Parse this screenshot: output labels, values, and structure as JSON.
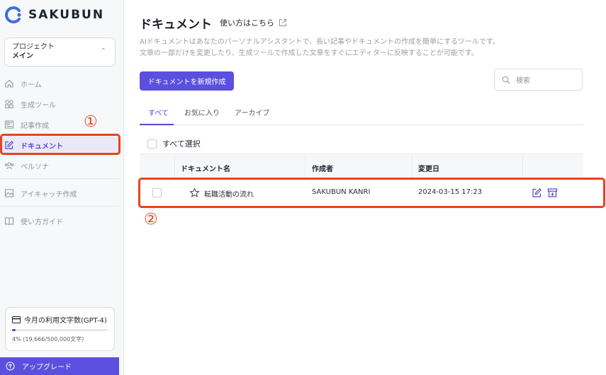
{
  "app": {
    "logo_text": "SAKUBUN"
  },
  "project": {
    "label": "プロジェクト",
    "name": "メイン"
  },
  "nav": [
    {
      "label": "ホーム",
      "icon": "home-icon"
    },
    {
      "label": "生成ツール",
      "icon": "grid-icon"
    },
    {
      "label": "記事作成",
      "icon": "article-icon"
    },
    {
      "label": "ドキュメント",
      "icon": "edit-icon",
      "active": true
    },
    {
      "label": "ペルソナ",
      "icon": "users-icon"
    },
    {
      "label": "アイキャッチ作成",
      "icon": "image-icon"
    },
    {
      "label": "使い方ガイド",
      "icon": "book-icon"
    }
  ],
  "usage": {
    "title": "今月の利用文字数(GPT-4)",
    "detail": "4% (19,666/500,000文字)",
    "percent": 4
  },
  "upgrade": {
    "label": "アップグレード"
  },
  "page": {
    "title": "ドキュメント",
    "howto": "使い方はこちら",
    "desc_line1": "AIドキュメントはあなたのパーソナルアシスタントで、長い記事やドキュメントの作成を簡単にするツールです。",
    "desc_line2": "文章の一部だけを変更したり、生成ツールで作成した文章をすぐにエディターに反映することが可能です。",
    "new_button": "ドキュメントを新規作成",
    "search_placeholder": "検索"
  },
  "tabs": [
    "すべて",
    "お気に入り",
    "アーカイブ"
  ],
  "select_all": "すべて選択",
  "table": {
    "headers": [
      "ドキュメント名",
      "作成者",
      "変更日"
    ],
    "rows": [
      {
        "name": "転職活動の流れ",
        "author": "SAKUBUN KANRI",
        "date": "2024-03-15 17:23"
      }
    ]
  },
  "annotations": {
    "one": "①",
    "two": "②",
    "color": "#e8431f"
  },
  "colors": {
    "accent": "#5b4fe0"
  }
}
